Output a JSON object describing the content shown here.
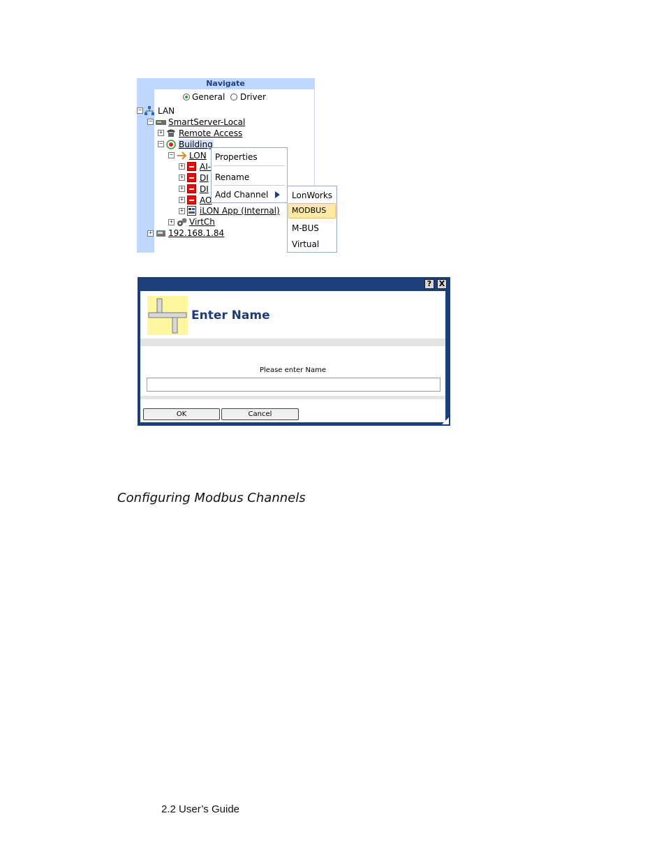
{
  "navigate": {
    "title": "Navigate",
    "radio_general": "General",
    "radio_driver": "Driver",
    "tree": {
      "lan": "LAN",
      "smartserver": "SmartServer-Local",
      "remote_access": "Remote Access",
      "building": "Building",
      "lon": "LON",
      "fb1": "AI-",
      "fb2": "DI",
      "fb3": "DI",
      "fb4": "AO",
      "ilon_app": "iLON App (Internal)",
      "virtch": "VirtCh",
      "ip_device": "192.168.1.84"
    }
  },
  "context_menu": {
    "properties": "Properties",
    "rename": "Rename",
    "add_channel": "Add Channel"
  },
  "submenu": {
    "lonworks": "LonWorks",
    "modbus": "MODBUS",
    "mbus": "M-BUS",
    "virtual": "Virtual"
  },
  "dialog": {
    "title": "Enter Name",
    "help_label": "?",
    "close_label": "X",
    "prompt": "Please enter Name",
    "name_value": "",
    "ok_label": "OK",
    "cancel_label": "Cancel"
  },
  "section_heading": "Configuring Modbus Channels",
  "footer": "2.2 User’s Guide",
  "colors": {
    "nav_header": "#bed7ff",
    "highlight": "#ffe9a6",
    "dialog_frame": "#1b3f7a",
    "title_text": "#1e3c78"
  }
}
